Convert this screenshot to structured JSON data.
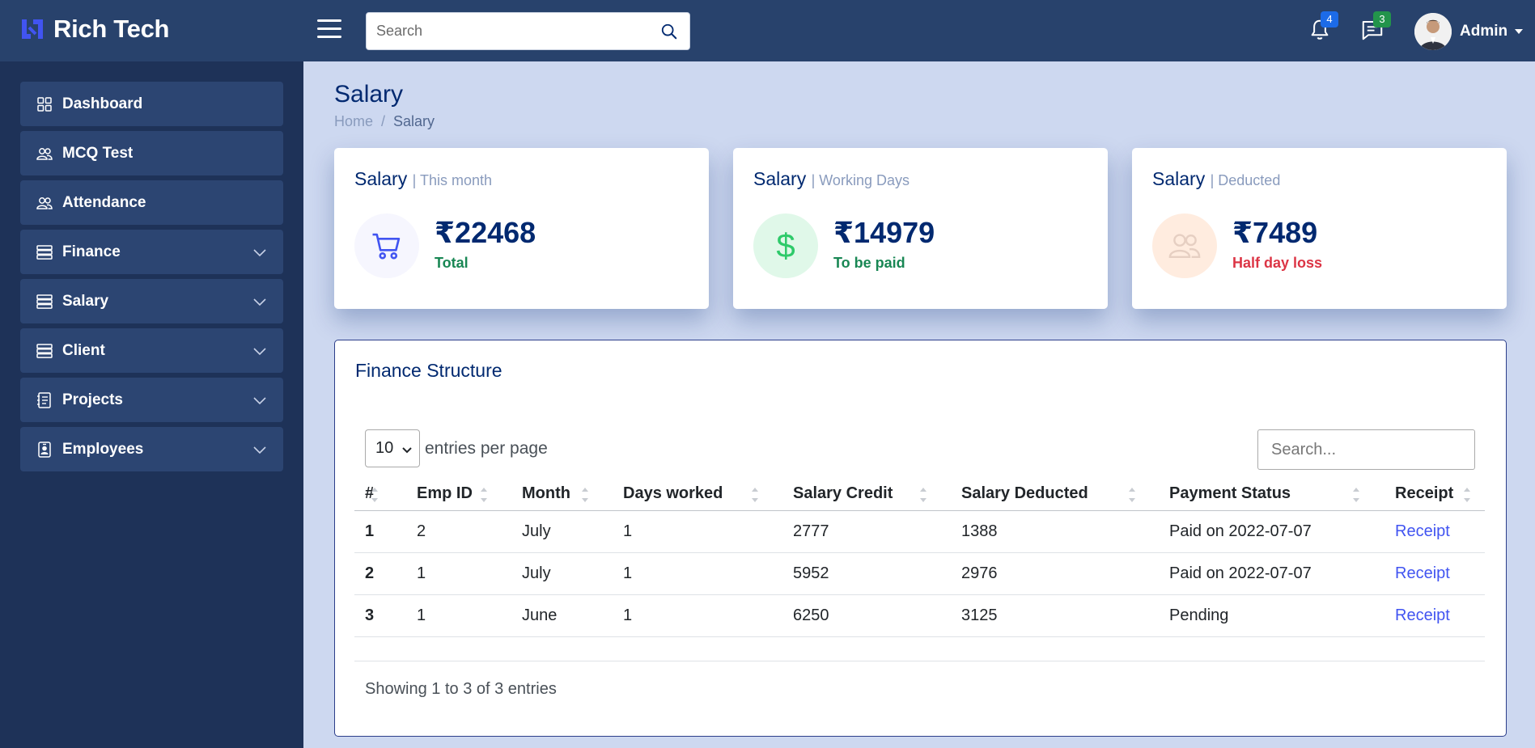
{
  "brand": {
    "name": "Rich Tech",
    "color": "#4154f1"
  },
  "header": {
    "search_placeholder": "Search",
    "notifications_count": "4",
    "messages_count": "3",
    "user_name": "Admin",
    "icons": [
      "menu-icon",
      "search-icon",
      "bell-icon",
      "chat-icon",
      "caret-down-icon"
    ]
  },
  "sidebar": {
    "items": [
      {
        "label": "Dashboard",
        "icon": "grid-icon",
        "expandable": false
      },
      {
        "label": "MCQ Test",
        "icon": "people-icon",
        "expandable": false
      },
      {
        "label": "Attendance",
        "icon": "people-icon",
        "expandable": false
      },
      {
        "label": "Finance",
        "icon": "server-icon",
        "expandable": true
      },
      {
        "label": "Salary",
        "icon": "server-icon",
        "expandable": true
      },
      {
        "label": "Client",
        "icon": "server-icon",
        "expandable": true
      },
      {
        "label": "Projects",
        "icon": "journal-icon",
        "expandable": true
      },
      {
        "label": "Employees",
        "icon": "person-badge-icon",
        "expandable": true
      }
    ]
  },
  "page": {
    "title": "Salary",
    "breadcrumb": {
      "home": "Home",
      "separator": "/",
      "current": "Salary"
    }
  },
  "cards": [
    {
      "title": "Salary",
      "subtitle": "| This month",
      "value": "₹22468",
      "label": "Total",
      "label_color": "#198754",
      "icon": "cart-icon",
      "circle_color": "#f6f6fe"
    },
    {
      "title": "Salary",
      "subtitle": "| Working Days",
      "value": "₹14979",
      "label": "To be paid",
      "label_color": "#198754",
      "icon": "dollar-icon",
      "circle_color": "#e0f8e9"
    },
    {
      "title": "Salary",
      "subtitle": "| Deducted",
      "value": "₹7489",
      "label": "Half day loss",
      "label_color": "#dc3545",
      "icon": "people-icon",
      "circle_color": "#ffecdf"
    }
  ],
  "finance": {
    "title": "Finance Structure",
    "per_page_value": "10",
    "per_page_label": "entries per page",
    "search_placeholder": "Search...",
    "columns": [
      "#",
      "Emp ID",
      "Month",
      "Days worked",
      "Salary Credit",
      "Salary Deducted",
      "Payment Status",
      "Receipt"
    ],
    "rows": [
      {
        "num": "1",
        "emp_id": "2",
        "month": "July",
        "days": "1",
        "credit": "2777",
        "deducted": "1388",
        "status": "Paid on 2022-07-07",
        "receipt": "Receipt"
      },
      {
        "num": "2",
        "emp_id": "1",
        "month": "July",
        "days": "1",
        "credit": "5952",
        "deducted": "2976",
        "status": "Paid on 2022-07-07",
        "receipt": "Receipt"
      },
      {
        "num": "3",
        "emp_id": "1",
        "month": "June",
        "days": "1",
        "credit": "6250",
        "deducted": "3125",
        "status": "Pending",
        "receipt": "Receipt"
      }
    ],
    "showing_text": "Showing 1 to 3 of 3 entries"
  }
}
